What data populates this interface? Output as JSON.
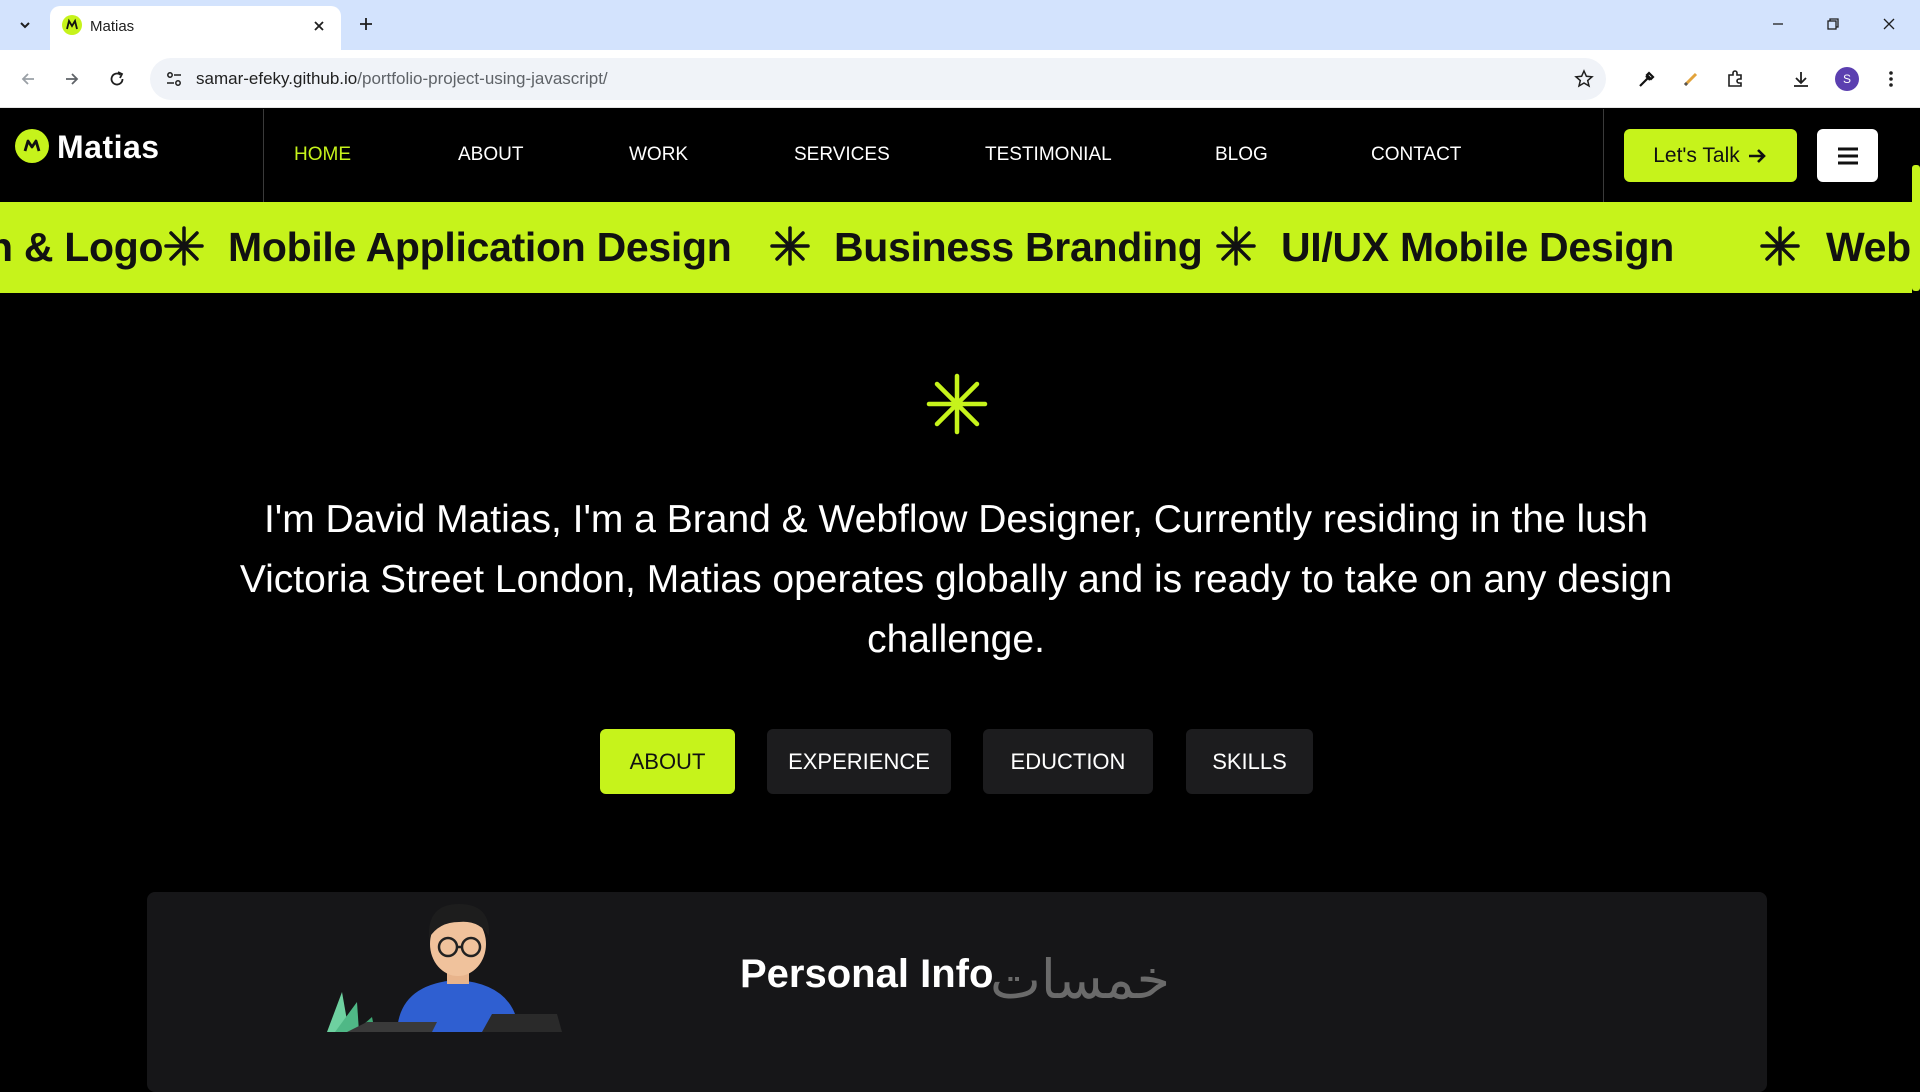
{
  "browser": {
    "tab_title": "Matias",
    "url_host": "samar-efeky.github.io",
    "url_path": "/portfolio-project-using-javascript/",
    "profile_initial": "S"
  },
  "header": {
    "logo": "Matias",
    "nav": [
      "HOME",
      "ABOUT",
      "WORK",
      "SERVICES",
      "TESTIMONIAL",
      "BLOG",
      "CONTACT"
    ],
    "active_nav": "HOME",
    "cta_label": "Let's Talk",
    "accent_color": "#c6f31b"
  },
  "marquee": {
    "items": [
      "n & Logo",
      "Mobile Application Design",
      "Business Branding",
      "UI/UX Mobile Design",
      "Web"
    ]
  },
  "hero": {
    "bio": "I'm David Matias, I'm a Brand & Webflow Designer, Currently residing in the lush Victoria Street London, Matias operates globally and is ready to take on any design challenge."
  },
  "tabs": {
    "items": [
      "ABOUT",
      "EXPERIENCE",
      "EDUCTION",
      "SKILLS"
    ],
    "active": "ABOUT"
  },
  "card": {
    "title": "Personal Info",
    "watermark": "خمسات"
  }
}
